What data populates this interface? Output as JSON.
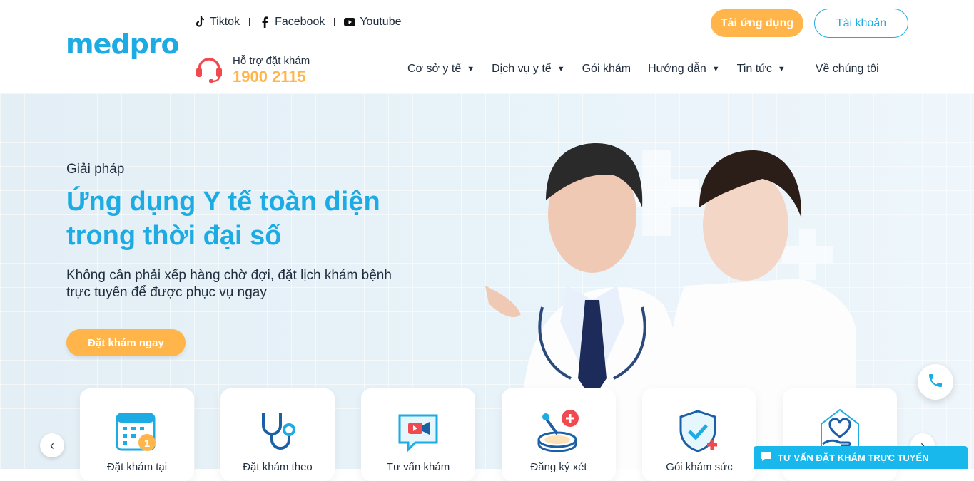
{
  "brand": {
    "logo": "medpro",
    "accent": "#1dabe4",
    "orange": "#ffb54a"
  },
  "social": [
    {
      "label": "Tiktok",
      "icon": "tiktok-icon"
    },
    {
      "label": "Facebook",
      "icon": "facebook-icon"
    },
    {
      "label": "Youtube",
      "icon": "youtube-icon"
    }
  ],
  "header": {
    "app_button": "Tải ứng dụng",
    "account_button": "Tài khoản"
  },
  "support": {
    "label": "Hỗ trợ đặt khám",
    "phone": "1900 2115"
  },
  "nav": [
    {
      "label": "Cơ sở y tế",
      "dropdown": true
    },
    {
      "label": "Dịch vụ y tế",
      "dropdown": true
    },
    {
      "label": "Gói khám",
      "dropdown": false
    },
    {
      "label": "Hướng dẫn",
      "dropdown": true
    },
    {
      "label": "Tin tức",
      "dropdown": true
    },
    {
      "label": "Về chúng tôi",
      "dropdown": false
    }
  ],
  "hero": {
    "eyebrow": "Giải pháp",
    "title_line1": "Ứng dụng Y tế toàn diện",
    "title_line2": "trong thời đại số",
    "desc_line1": "Không cần phải xếp hàng chờ đợi, đặt lịch khám bệnh",
    "desc_line2": "trực tuyến để được phục vụ ngay",
    "cta": "Đặt khám ngay"
  },
  "services": [
    {
      "label": "Đặt khám tại",
      "icon": "calendar-icon"
    },
    {
      "label": "Đặt khám theo",
      "icon": "stethoscope-icon"
    },
    {
      "label": "Tư vấn khám",
      "icon": "video-call-icon"
    },
    {
      "label": "Đăng ký xét",
      "icon": "lab-test-icon"
    },
    {
      "label": "Gói khám sức",
      "icon": "shield-health-icon"
    },
    {
      "label": "",
      "icon": "heart-hand-icon"
    }
  ],
  "chat": {
    "label": "TƯ VẤN ĐẶT KHÁM TRỰC TUYẾN"
  }
}
